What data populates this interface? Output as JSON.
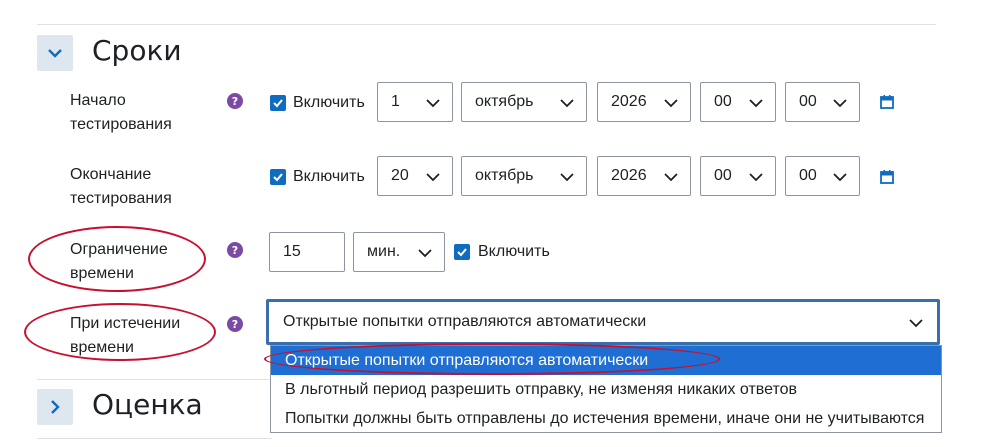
{
  "sections": {
    "timing": {
      "title": "Сроки",
      "expanded": true
    },
    "grade": {
      "title": "Оценка",
      "expanded": false
    }
  },
  "open_row": {
    "label_line1": "Начало",
    "label_line2": "тестирования",
    "enable_label": "Включить",
    "enabled": true,
    "day": "1",
    "month": "октябрь",
    "year": "2026",
    "hour": "00",
    "minute": "00"
  },
  "close_row": {
    "label_line1": "Окончание",
    "label_line2": "тестирования",
    "enable_label": "Включить",
    "enabled": true,
    "day": "20",
    "month": "октябрь",
    "year": "2026",
    "hour": "00",
    "minute": "00"
  },
  "time_limit": {
    "label_line1": "Ограничение",
    "label_line2": "времени",
    "value": "15",
    "unit": "мин.",
    "enable_label": "Включить",
    "enabled": true
  },
  "when_expires": {
    "label_line1": "При истечении",
    "label_line2": "времени",
    "selected": "Открытые попытки отправляются автоматически",
    "options": [
      "Открытые попытки отправляются автоматически",
      "В льготный период разрешить отправку, не изменяя никаких ответов",
      "Попытки должны быть отправлены до истечения времени, иначе они не учитываются"
    ]
  },
  "help_glyph": "?",
  "icons": {
    "help": "question-circle-icon",
    "calendar": "calendar-icon",
    "check": "check-icon",
    "chevron": "chevron-down-icon"
  },
  "colors": {
    "accent": "#0f6cbf",
    "help": "#7b4aa5",
    "highlight": "#1f6ed4",
    "annotation": "#c8102e"
  }
}
